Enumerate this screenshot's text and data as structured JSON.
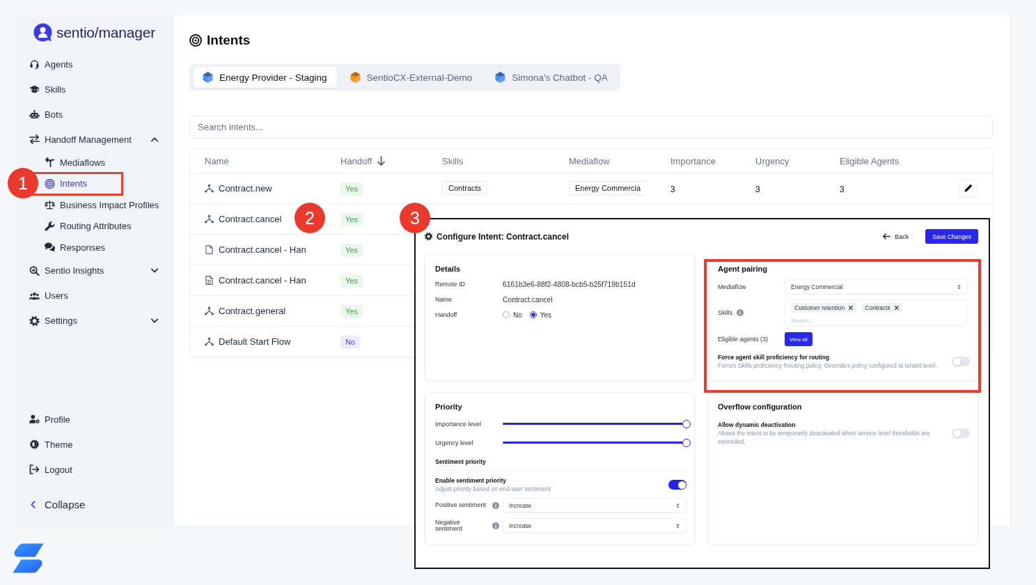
{
  "sidebar": {
    "logo": "sentio/manager",
    "items": [
      {
        "label": "Agents",
        "selected": false
      },
      {
        "label": "Skills",
        "selected": false
      },
      {
        "label": "Bots",
        "selected": false
      },
      {
        "label": "Handoff Management",
        "selected": false,
        "expanded": true,
        "children": [
          {
            "label": "Mediaflows",
            "selected": false
          },
          {
            "label": "Intents",
            "selected": true
          },
          {
            "label": "Business Impact Profiles",
            "selected": false
          },
          {
            "label": "Routing Attributes",
            "selected": false
          },
          {
            "label": "Responses",
            "selected": false
          }
        ]
      },
      {
        "label": "Sentio Insights",
        "selected": false,
        "expanded": false
      },
      {
        "label": "Users",
        "selected": false
      },
      {
        "label": "Settings",
        "selected": false,
        "expanded": false
      }
    ],
    "bottom_items": [
      {
        "label": "Profile",
        "selected": false
      },
      {
        "label": "Theme",
        "selected": false
      },
      {
        "label": "Logout",
        "selected": false
      }
    ],
    "collapse": "Collapse"
  },
  "page": {
    "title": "Intents"
  },
  "tabs": [
    {
      "label": "Energy Provider - Staging",
      "selected": true,
      "color": "#4a8ff2"
    },
    {
      "label": "SentioCX-External-Demo",
      "selected": false,
      "color": "#f5931e"
    },
    {
      "label": "Simona's Chatbot - QA",
      "selected": false,
      "color": "#4a8ff2"
    }
  ],
  "search": {
    "placeholder": "Search intents..."
  },
  "table": {
    "columns": [
      {
        "label": "Name",
        "sorted": false
      },
      {
        "label": "Handoff",
        "sorted": true
      },
      {
        "label": "Skills",
        "sorted": false
      },
      {
        "label": "Mediaflow",
        "sorted": false
      },
      {
        "label": "Importance",
        "sorted": false
      },
      {
        "label": "Urgency",
        "sorted": false
      },
      {
        "label": "Eligible Agents",
        "sorted": false
      }
    ],
    "rows": [
      {
        "kind": "flow",
        "name": "Contract.new",
        "handoff": true,
        "handoff_label": "Yes",
        "skills": [
          "Contracts"
        ],
        "mediaflow": "Energy Commercia",
        "importance": "3",
        "urgency": "3",
        "eligible_agents": "3"
      },
      {
        "kind": "flow",
        "name": "Contract.cancel",
        "handoff": true,
        "handoff_label": "Yes"
      },
      {
        "kind": "document",
        "name": "Contract.cancel - Han",
        "handoff": true,
        "handoff_label": "Yes"
      },
      {
        "kind": "form",
        "name": "Contract.cancel - Han",
        "handoff": true,
        "handoff_label": "Yes"
      },
      {
        "kind": "flow",
        "name": "Contract.general",
        "handoff": true,
        "handoff_label": "Yes"
      },
      {
        "kind": "flow",
        "name": "Default Start Flow",
        "handoff": false,
        "handoff_label": "No"
      }
    ]
  },
  "dialog": {
    "title": "Configure Intent: Contract.cancel",
    "back": "Back",
    "save": "Save Changes",
    "details": {
      "title": "Details",
      "fields": [
        {
          "kind": "text",
          "label": "Remote ID",
          "value": "6161b3e6-88f2-4808-bcb5-b25f719b151d"
        },
        {
          "kind": "text",
          "label": "Name",
          "value": "Contract.cancel"
        },
        {
          "kind": "radio",
          "label": "Handoff",
          "options": [
            {
              "label": "No",
              "selected": false
            },
            {
              "label": "Yes",
              "selected": true
            }
          ]
        }
      ]
    },
    "priority": {
      "title": "Priority",
      "sliders": [
        {
          "label": "Importance level",
          "level": 1
        },
        {
          "label": "Urgency level",
          "level": 1
        }
      ],
      "sentiment_title": "Sentiment priority",
      "sentiment_toggle": {
        "label": "Enable sentiment priority",
        "description": "Adjust priority based on end-user sentiment",
        "on": true
      },
      "selects": [
        {
          "label": "Positive sentiment",
          "value": "Increase"
        },
        {
          "label": "Negative sentiment",
          "value": "Increase"
        }
      ]
    },
    "agent_pairing": {
      "title": "Agent pairing",
      "mediaflow_label": "Mediaflow",
      "mediaflow": "Energy Commercial",
      "skills_label": "Skills",
      "skills": [
        "Customer retention",
        "Contracts"
      ],
      "skills_placeholder": "Search...",
      "eligible_label": "Eligible agents (3)",
      "view_all": "View all",
      "force_toggle": {
        "label": "Force agent skill proficiency for routing",
        "description": "Forces Skills proficiency Routing policy. Overrides policy configured at tenant level.",
        "on": false
      }
    },
    "overflow": {
      "title": "Overflow configuration",
      "toggle": {
        "label": "Allow dynamic deactivation",
        "description": "Allows the intent to be temporarily deactivated when service level thresholds are exceeded.",
        "on": false
      }
    }
  },
  "annotations": [
    {
      "label": "1"
    },
    {
      "label": "2"
    },
    {
      "label": "3"
    }
  ]
}
